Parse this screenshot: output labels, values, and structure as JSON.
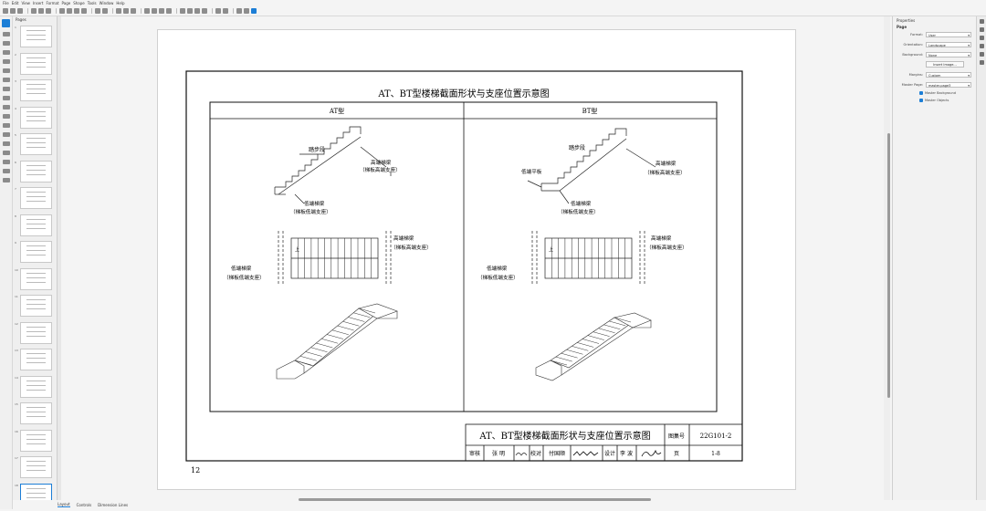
{
  "menu": [
    "File",
    "Edit",
    "View",
    "Insert",
    "Format",
    "Page",
    "Shape",
    "Tools",
    "Window",
    "Help"
  ],
  "pages_panel": {
    "title": "Pages",
    "numbers": [
      "1",
      "2",
      "3",
      "4",
      "5",
      "6",
      "7",
      "8",
      "9",
      "10",
      "11",
      "12",
      "13",
      "14",
      "15",
      "16",
      "17",
      "18"
    ],
    "selected_index": 17
  },
  "drawing": {
    "title": "AT、BT型楼梯截面形状与支座位置示意图",
    "at": {
      "header": "AT型",
      "step": "踏步段",
      "high_beam": "高端梯梁",
      "high_support": "（梯板高端支座）",
      "low_beam": "低端梯梁",
      "low_support": "（梯板低端支座）",
      "up": "上"
    },
    "bt": {
      "header": "BT型",
      "step": "踏步段",
      "low_slab": "低端平板",
      "high_beam": "高端梯梁",
      "high_support": "（梯板高端支座）",
      "low_beam": "低端梯梁",
      "low_support": "（梯板低端支座）",
      "up": "上"
    },
    "title_block": {
      "title": "AT、BT型楼梯截面形状与支座位置示意图",
      "atlas_label": "图集号",
      "atlas_no": "22G101-2",
      "review": "审核",
      "reviewer": "张 明",
      "check": "校对",
      "checker": "付国顺",
      "design": "设计",
      "designer": "李 波",
      "page_label": "页",
      "page_no": "1-8"
    },
    "page_number": "12"
  },
  "properties": {
    "panel_title": "Properties",
    "section": "Page",
    "format_label": "Format:",
    "format_value": "User",
    "orientation_label": "Orientation:",
    "orientation_value": "Landscape",
    "background_label": "Background:",
    "background_value": "None",
    "insert_image": "Insert Image...",
    "margins_label": "Margins:",
    "margins_value": "Custom",
    "master_label": "Master Page:",
    "master_value": "master-page3",
    "master_background": "Master Background",
    "master_objects": "Master Objects"
  },
  "tabs": [
    "Layout",
    "Controls",
    "Dimension Lines"
  ]
}
